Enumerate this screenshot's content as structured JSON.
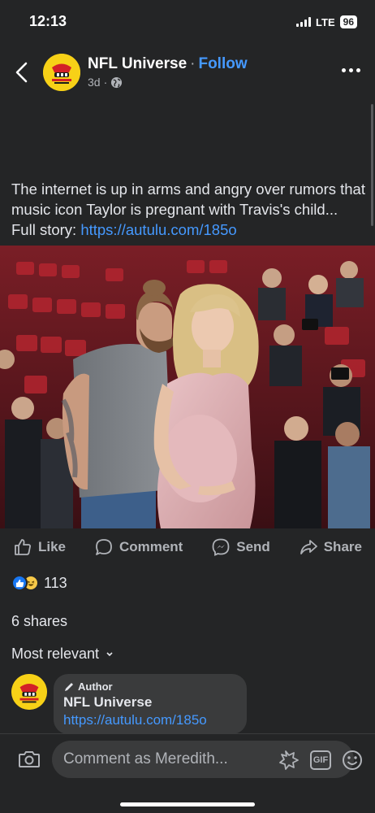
{
  "status_bar": {
    "time": "12:13",
    "network": "LTE",
    "battery": "96"
  },
  "header": {
    "page_name": "NFL Universe",
    "separator": "·",
    "follow_label": "Follow",
    "time_ago": "3d",
    "time_separator": "·",
    "icons": [
      "back-arrow-icon",
      "globe-icon",
      "more-icon"
    ]
  },
  "post": {
    "text": "The internet is up in arms and angry over rumors that music icon Taylor is pregnant with Travis's child... Full story: ",
    "link": "https://autulu.com/185o"
  },
  "actions": {
    "like": "Like",
    "comment": "Comment",
    "send": "Send",
    "share": "Share"
  },
  "reactions": {
    "count": "113",
    "types": [
      "like",
      "haha"
    ]
  },
  "shares": "6 shares",
  "sort": {
    "label": "Most relevant"
  },
  "comment": {
    "badge": "Author",
    "name": "NFL Universe",
    "link": "https://autulu.com/185o"
  },
  "composer": {
    "placeholder": "Comment as Meredith..."
  },
  "colors": {
    "background": "#242526",
    "link": "#4599ff",
    "avatar": "#f7d117",
    "like_blue": "#1877f2"
  }
}
